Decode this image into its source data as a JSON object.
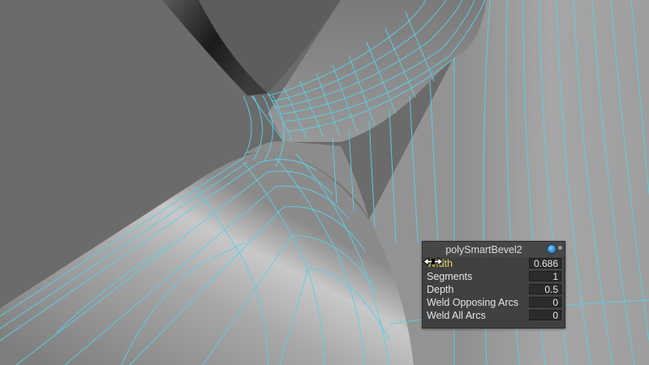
{
  "panel": {
    "title": "polySmartBevel2",
    "attributes": [
      {
        "label": "Width",
        "value": "0.686",
        "active": true
      },
      {
        "label": "Segments",
        "value": "1"
      },
      {
        "label": "Depth",
        "value": "0.5"
      },
      {
        "label": "Weld Opposing Arcs",
        "value": "0"
      },
      {
        "label": "Weld All Arcs",
        "value": "0"
      }
    ]
  },
  "icons": {
    "menu": "panel-menu-icon",
    "close": "panel-close-icon",
    "cursor": "drag-cursor-icon"
  },
  "colors": {
    "wireframe": "#5ccfe6",
    "mesh_light": "#a8a8a8",
    "mesh_dark": "#3a3a3a",
    "active_label": "#e3d35c"
  }
}
